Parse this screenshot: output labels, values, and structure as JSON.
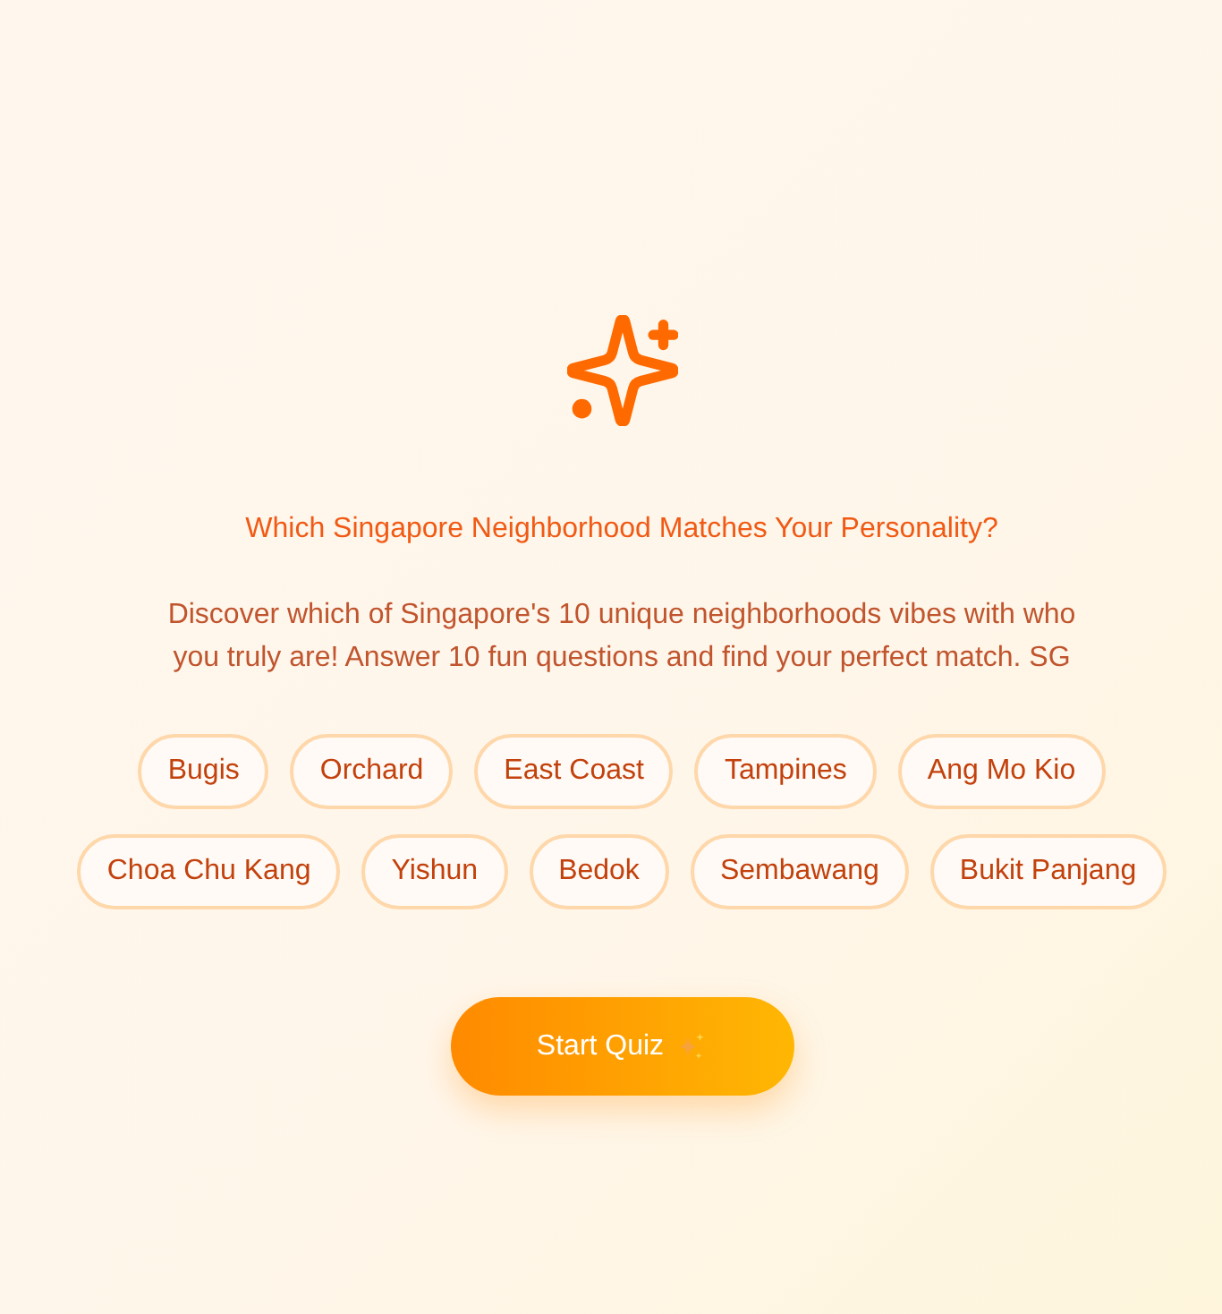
{
  "intro": {
    "title": "Which Singapore Neighborhood Matches Your Personality?",
    "description": "Discover which of Singapore's 10 unique neighborhoods vibes with who you truly are! Answer 10 fun questions and find your perfect match. SG"
  },
  "neighborhoods": [
    "Bugis",
    "Orchard",
    "East Coast",
    "Tampines",
    "Ang Mo Kio",
    "Choa Chu Kang",
    "Yishun",
    "Bedok",
    "Sembawang",
    "Bukit Panjang"
  ],
  "start_button": {
    "label": "Start Quiz"
  }
}
